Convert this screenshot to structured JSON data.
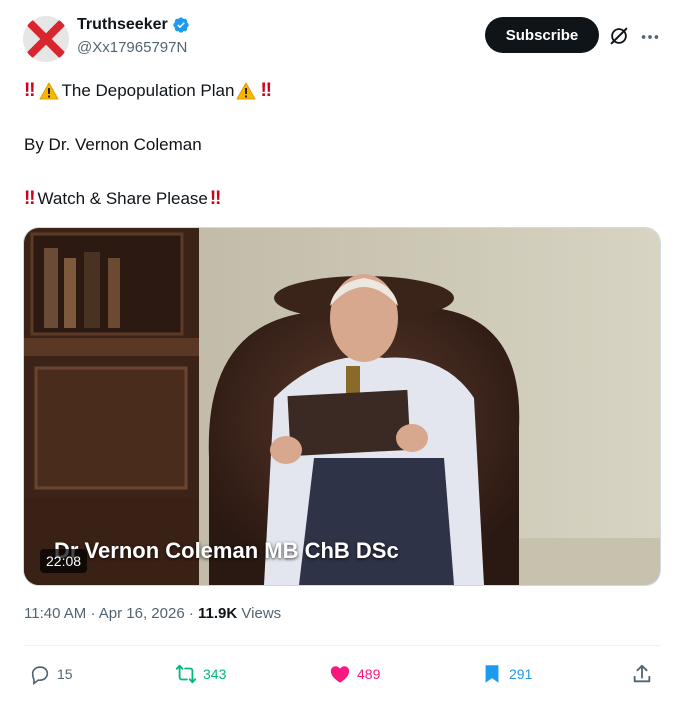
{
  "author": {
    "display_name": "Truthseeker",
    "handle": "@Xx17965797N",
    "verified": true
  },
  "subscribe_label": "Subscribe",
  "post": {
    "line1_text": "The Depopulation Plan",
    "line2_text": "By Dr. Vernon Coleman",
    "line3_text": "Watch & Share Please",
    "double_bang": "‼"
  },
  "video": {
    "caption": "Dr Vernon Coleman MB ChB DSc",
    "duration": "22:08"
  },
  "meta": {
    "time": "11:40 AM",
    "separator": "·",
    "date": "Apr 16, 2026",
    "views_count": "11.9K",
    "views_label": "Views"
  },
  "actions": {
    "replies": "15",
    "reposts": "343",
    "likes": "489",
    "bookmarks": "291"
  },
  "colors": {
    "repost_green": "#00ba7c",
    "like_pink": "#f91880",
    "bookmark_blue": "#1d9bf0",
    "verified_blue": "#1d9bf0"
  },
  "icons": [
    "avatar-x-icon",
    "verified-icon",
    "grok-icon",
    "more-icon",
    "warning-icon",
    "reply-icon",
    "repost-icon",
    "like-icon",
    "bookmark-icon",
    "share-icon"
  ]
}
